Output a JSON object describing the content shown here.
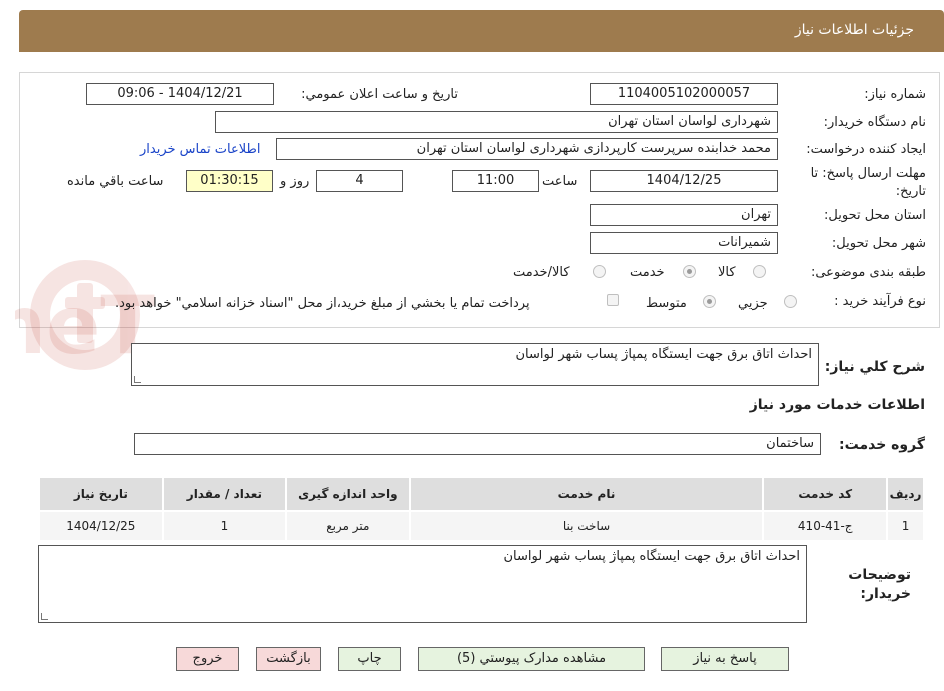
{
  "header": {
    "title": "جزئیات اطلاعات نیاز"
  },
  "form": {
    "need_number_label": "شماره نیاز:",
    "need_number": "1104005102000057",
    "announce_label": "تاریخ و ساعت اعلان عمومي:",
    "announce_value": "1404/12/21 - 09:06",
    "buyer_org_label": "نام دستگاه خريدار:",
    "buyer_org": "شهرداری لواسان استان تهران",
    "requester_label": "ايجاد کننده درخواست:",
    "requester": "محمد خدابنده سرپرست کارپردازی شهرداری لواسان استان تهران",
    "contact_link": "اطلاعات تماس خريدار",
    "deadline_label_1": "مهلت ارسال پاسخ: تا",
    "deadline_label_2": "تاريخ:",
    "deadline_date": "1404/12/25",
    "time_label": "ساعت",
    "deadline_time": "11:00",
    "days_value": "4",
    "days_label": "روز و",
    "remaining_time": "01:30:15",
    "remaining_label": "ساعت باقي مانده",
    "province_label": "استان محل تحويل:",
    "province": "تهران",
    "city_label": "شهر محل تحويل:",
    "city": "شمیرانات",
    "category_label": "طبقه بندی موضوعی:",
    "category_options": [
      "کالا",
      "خدمت",
      "کالا/خدمت"
    ],
    "category_selected": "خدمت",
    "process_label": "نوع فرآيند خريد :",
    "process_options": [
      "جزيي",
      "متوسط"
    ],
    "process_selected": "متوسط",
    "payment_note": "پرداخت تمام يا بخشي از مبلغ خريد،از محل \"اسناد خزانه اسلامي\" خواهد بود."
  },
  "summary": {
    "label": "شرح کلي نياز:",
    "text": "احداث اتاق برق جهت ایستگاه پمپاژ پساب شهر لواسان"
  },
  "services": {
    "section_title": "اطلاعات خدمات مورد نياز",
    "group_label": "گروه خدمت:",
    "group_value": "ساختمان",
    "columns": [
      "رديف",
      "کد خدمت",
      "نام خدمت",
      "واحد اندازه گيری",
      "تعداد / مقدار",
      "تاريخ نياز"
    ],
    "rows": [
      {
        "index": "1",
        "code": "ج-41-410",
        "name": "ساخت بنا",
        "unit": "متر مربع",
        "qty": "1",
        "date": "1404/12/25"
      }
    ]
  },
  "buyer_notes": {
    "label_1": "توضيحات",
    "label_2": "خريدار:",
    "text": "احداث اتاق برق جهت ایستگاه پمپاژ پساب شهر لواسان"
  },
  "buttons": {
    "reply": "پاسخ به نياز",
    "attachments": "مشاهده مدارک پيوستي (5)",
    "print": "چاپ",
    "back": "بازگشت",
    "exit": "خروج"
  },
  "watermark": {
    "text": "AriaTender.neT"
  },
  "colors": {
    "header": "#9e7b4e",
    "button_green": "#e6f3df",
    "button_pink": "#f7d9d9",
    "link": "#1a44c8"
  }
}
